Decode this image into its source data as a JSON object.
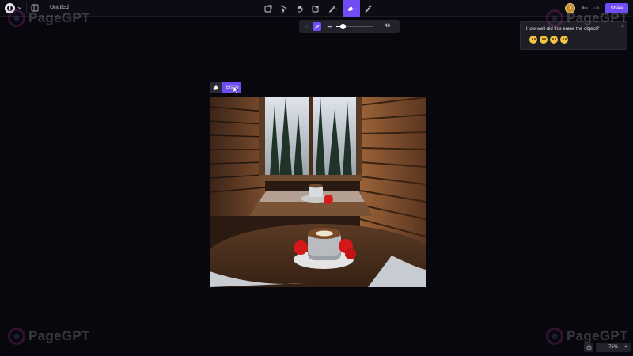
{
  "header": {
    "doc_title": "Untitled",
    "avatar_initial": "J",
    "share_label": "Share",
    "tools": [
      {
        "name": "select-icon"
      },
      {
        "name": "pointer-icon"
      },
      {
        "name": "hand-icon"
      },
      {
        "name": "edit-icon"
      },
      {
        "name": "pen-dropdown-icon"
      },
      {
        "name": "magic-erase-icon",
        "active": true
      },
      {
        "name": "eyedropper-icon"
      }
    ]
  },
  "subtoolbar": {
    "brush_size": "48",
    "brush_fraction": 0.18
  },
  "feedback": {
    "question": "How well did this erase the object?",
    "close": "×",
    "ratings": [
      "very-bad",
      "bad",
      "neutral",
      "good"
    ]
  },
  "canvas": {
    "erase_label": "Erase"
  },
  "watermarks": {
    "text": "PageGPT"
  },
  "zoom": {
    "minus": "−",
    "level": "75%",
    "plus": "+"
  },
  "colors": {
    "accent": "#6f4cf5",
    "background": "#07070d",
    "panel": "#22222b"
  }
}
